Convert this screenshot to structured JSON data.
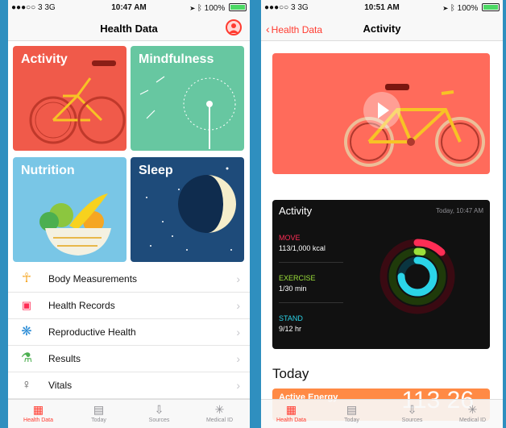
{
  "left": {
    "status": {
      "carrier": "●●●○○ 3  3G",
      "time": "10:47 AM",
      "battery": "100%"
    },
    "nav_title": "Health Data",
    "tiles": {
      "activity": "Activity",
      "mindfulness": "Mindfulness",
      "nutrition": "Nutrition",
      "sleep": "Sleep"
    },
    "rows": [
      {
        "label": "Body Measurements",
        "icon": "body-icon"
      },
      {
        "label": "Health Records",
        "icon": "records-icon"
      },
      {
        "label": "Reproductive Health",
        "icon": "reproductive-icon"
      },
      {
        "label": "Results",
        "icon": "flask-icon"
      },
      {
        "label": "Vitals",
        "icon": "stethoscope-icon"
      }
    ]
  },
  "right": {
    "status": {
      "carrier": "●●●○○ 3  3G",
      "time": "10:51 AM",
      "battery": "100%"
    },
    "back_label": "Health Data",
    "nav_title": "Activity",
    "card": {
      "title": "Activity",
      "time": "Today, 10:47 AM",
      "move_label": "MOVE",
      "move_value": "113/1,000 kcal",
      "exercise_label": "EXERCISE",
      "exercise_value": "1/30 min",
      "stand_label": "STAND",
      "stand_value": "9/12 hr"
    },
    "today_header": "Today",
    "energy_label": "Active Energy",
    "energy_value": "113 26"
  },
  "tabs": [
    "Health Data",
    "Today",
    "Sources",
    "Medical ID"
  ],
  "colors": {
    "accent": "#ff3b30",
    "move": "#ff2d55",
    "exercise": "#9be03a",
    "stand": "#2bd4e8"
  }
}
